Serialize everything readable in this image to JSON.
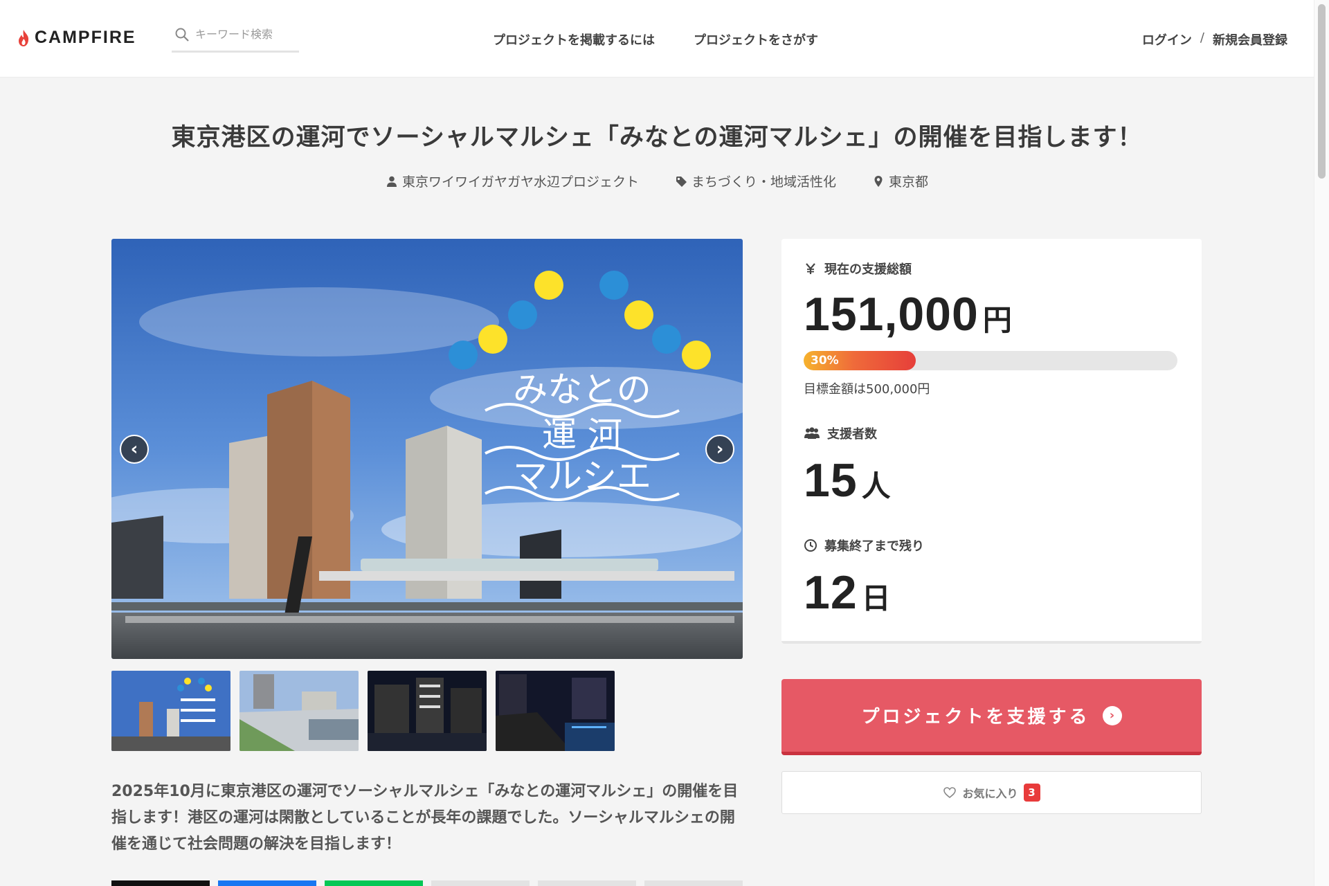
{
  "header": {
    "logo_text": "CAMPFIRE",
    "search_placeholder": "キーワード検索",
    "nav": {
      "post_project": "プロジェクトを掲載するには",
      "find_project": "プロジェクトをさがす"
    },
    "auth": {
      "login": "ログイン",
      "separator": "/",
      "register": "新規会員登録"
    }
  },
  "project": {
    "title": "東京港区の運河でソーシャルマルシェ「みなとの運河マルシェ」の開催を目指します！",
    "owner": "東京ワイワイガヤガヤ水辺プロジェクト",
    "category": "まちづくり・地域活性化",
    "location": "東京都",
    "hero_logo_text": [
      "みなとの",
      "運 河",
      "マルシエ"
    ],
    "description": "2025年10月に東京港区の運河でソーシャルマルシェ「みなとの運河マルシェ」の開催を目指します！港区の運河は閑散としていることが長年の課題でした。ソーシャルマルシェの開催を通じて社会問題の解決を目指します！"
  },
  "stats": {
    "total_label": "現在の支援総額",
    "total_value": "151,000",
    "total_unit": "円",
    "progress_percent": 30,
    "progress_label": "30%",
    "goal_text": "目標金額は500,000円",
    "backers_label": "支援者数",
    "backers_value": "15",
    "backers_unit": "人",
    "remaining_label": "募集終了まで残り",
    "remaining_value": "12",
    "remaining_unit": "日"
  },
  "actions": {
    "support_label": "プロジェクトを支援する",
    "favorite_label": "お気に入り",
    "favorite_count": "3"
  },
  "colors": {
    "accent": "#e65965",
    "logo_flame": "#e8413a",
    "badge": "#e83b3b"
  },
  "icons": {
    "yen": "yen-icon",
    "backers": "people-icon",
    "remaining": "clock-icon"
  }
}
